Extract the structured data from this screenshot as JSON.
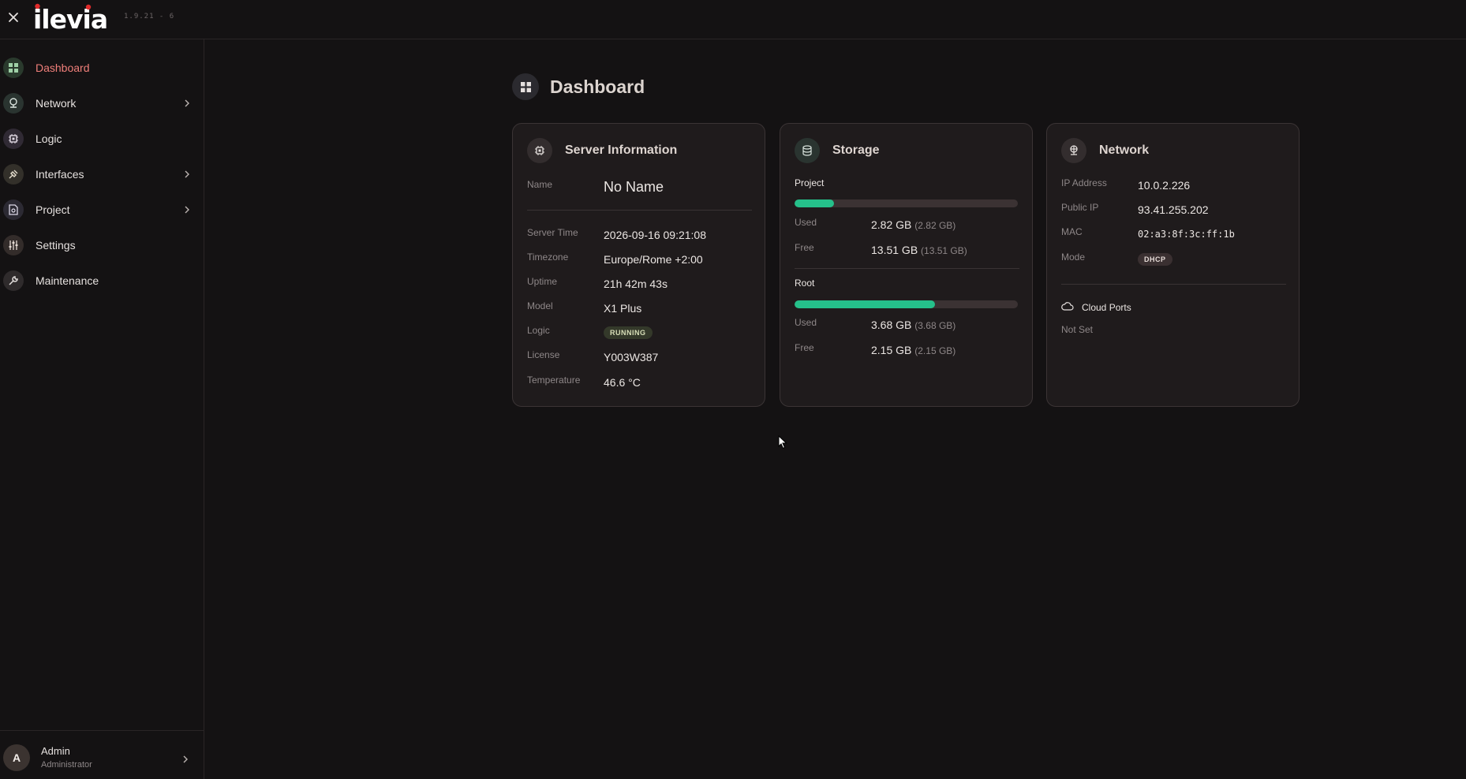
{
  "app": {
    "logo_text": "ilevia",
    "version": "1.9.21 - 6",
    "close_icon": "close-icon"
  },
  "sidebar": {
    "items": [
      {
        "label": "Dashboard",
        "icon": "dashboard-icon",
        "active": true,
        "has_children": false
      },
      {
        "label": "Network",
        "icon": "network-icon",
        "active": false,
        "has_children": true
      },
      {
        "label": "Logic",
        "icon": "logic-icon",
        "active": false,
        "has_children": false
      },
      {
        "label": "Interfaces",
        "icon": "plug-icon",
        "active": false,
        "has_children": true
      },
      {
        "label": "Project",
        "icon": "project-icon",
        "active": false,
        "has_children": true
      },
      {
        "label": "Settings",
        "icon": "sliders-icon",
        "active": false,
        "has_children": false
      },
      {
        "label": "Maintenance",
        "icon": "wrench-icon",
        "active": false,
        "has_children": false
      }
    ],
    "user": {
      "initial": "A",
      "name": "Admin",
      "role": "Administrator"
    }
  },
  "page": {
    "title": "Dashboard"
  },
  "server": {
    "title": "Server Information",
    "name_label": "Name",
    "name_value": "No Name",
    "rows": [
      {
        "label": "Server Time",
        "value": "2026-09-16 09:21:08"
      },
      {
        "label": "Timezone",
        "value": "Europe/Rome +2:00"
      },
      {
        "label": "Uptime",
        "value": "21h 42m 43s"
      },
      {
        "label": "Model",
        "value": "X1 Plus"
      },
      {
        "label": "Logic",
        "value": "RUNNING"
      },
      {
        "label": "License",
        "value": "Y003W387"
      },
      {
        "label": "Temperature",
        "value": "46.6 °C"
      }
    ]
  },
  "storage": {
    "title": "Storage",
    "sections": [
      {
        "name": "Project",
        "used_fraction": 0.175,
        "used_label": "Used",
        "used_value": "2.82 GB",
        "used_sub": "(2.82 GB)",
        "free_label": "Free",
        "free_value": "13.51 GB",
        "free_sub": "(13.51 GB)"
      },
      {
        "name": "Root",
        "used_fraction": 0.63,
        "used_label": "Used",
        "used_value": "3.68 GB",
        "used_sub": "(3.68 GB)",
        "free_label": "Free",
        "free_value": "2.15 GB",
        "free_sub": "(2.15 GB)"
      }
    ]
  },
  "network": {
    "title": "Network",
    "rows": [
      {
        "label": "IP Address",
        "value": "10.0.2.226"
      },
      {
        "label": "Public IP",
        "value": "93.41.255.202"
      },
      {
        "label": "MAC",
        "value": "02:a3:8f:3c:ff:1b"
      },
      {
        "label": "Mode",
        "value": "DHCP"
      }
    ],
    "cloud_label": "Cloud Ports",
    "cloud_value": "Not Set"
  },
  "colors": {
    "accent_active": "#f07f7a",
    "bar_fill": "#25c08a"
  }
}
